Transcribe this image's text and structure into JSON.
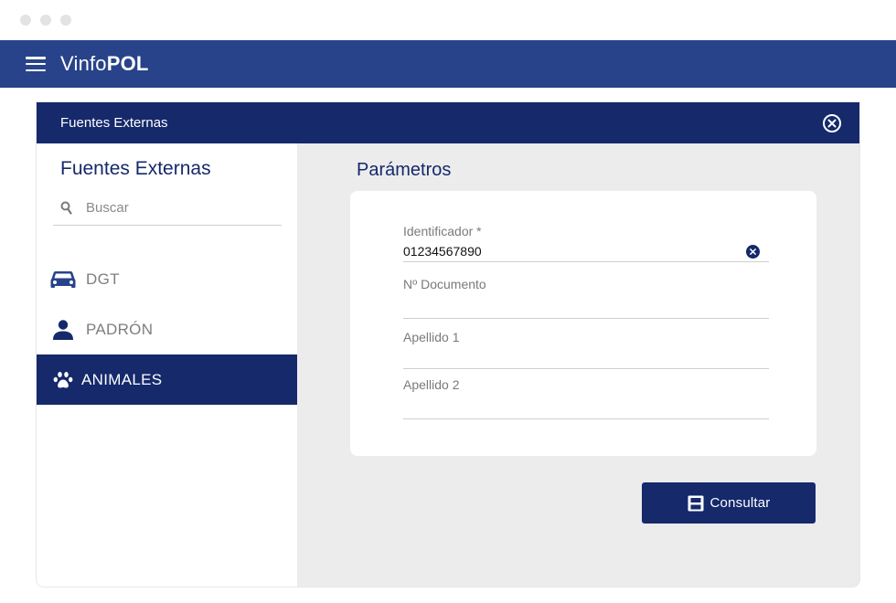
{
  "app": {
    "brand_prefix": "Vinfo",
    "brand_suffix": "POL"
  },
  "dialog": {
    "title": "Fuentes Externas"
  },
  "sidebar": {
    "title": "Fuentes Externas",
    "search_placeholder": "Buscar",
    "items": [
      {
        "label": "DGT",
        "icon": "car-icon",
        "active": false
      },
      {
        "label": "PADRÓN",
        "icon": "person-icon",
        "active": false
      },
      {
        "label": "ANIMALES",
        "icon": "paw-icon",
        "active": true
      }
    ]
  },
  "main": {
    "section_title": "Parámetros",
    "fields": {
      "identificador": {
        "label": "Identificador *",
        "value": "01234567890"
      },
      "documento": {
        "label": "Nº Documento",
        "value": ""
      },
      "apellido1": {
        "label": "Apellido 1",
        "value": ""
      },
      "apellido2": {
        "label": "Apellido 2",
        "value": ""
      }
    },
    "submit_label": "Consultar"
  },
  "colors": {
    "header": "#28438a",
    "primary": "#15296b",
    "panel": "#ececec"
  }
}
